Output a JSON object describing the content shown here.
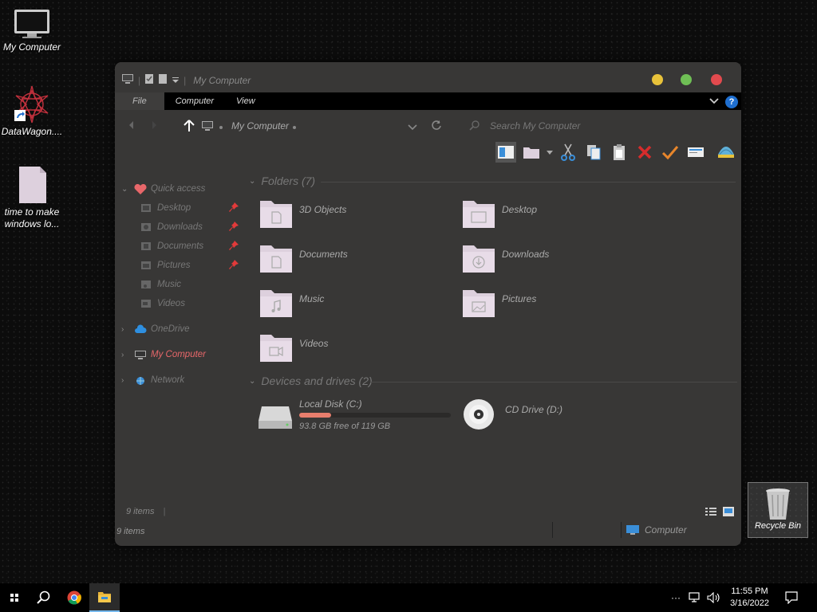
{
  "desktop": {
    "icons": [
      {
        "label": "My Computer"
      },
      {
        "label": "DataWagon...."
      },
      {
        "label": "time to make windows lo..."
      }
    ],
    "recycle_bin": "Recycle Bin"
  },
  "window": {
    "title": "My Computer",
    "ribbon_tabs": [
      "File",
      "Computer",
      "View"
    ],
    "help": "?",
    "address": "My Computer",
    "search_placeholder": "Search My Computer"
  },
  "nav": {
    "quick_access": "Quick access",
    "quick_items": [
      "Desktop",
      "Downloads",
      "Documents",
      "Pictures",
      "Music",
      "Videos"
    ],
    "onedrive": "OneDrive",
    "my_computer": "My Computer",
    "network": "Network"
  },
  "content": {
    "folders_header": "Folders (7)",
    "folders": [
      "3D Objects",
      "Desktop",
      "Documents",
      "Downloads",
      "Music",
      "Pictures",
      "Videos"
    ],
    "drives_header": "Devices and drives (2)",
    "drives": [
      {
        "name": "Local Disk (C:)",
        "free": "93.8 GB free of 119 GB",
        "used_fraction": 0.21
      },
      {
        "name": "CD Drive (D:)"
      }
    ]
  },
  "status": {
    "items_top": "9 items",
    "items_bottom": "9 items",
    "location": "Computer"
  },
  "taskbar": {
    "time": "11:55 PM",
    "date": "3/16/2022",
    "overflow": "···"
  },
  "colors": {
    "accent_red": "#e8676a",
    "window_bg": "#383736",
    "folder": "#ddd0dd"
  }
}
